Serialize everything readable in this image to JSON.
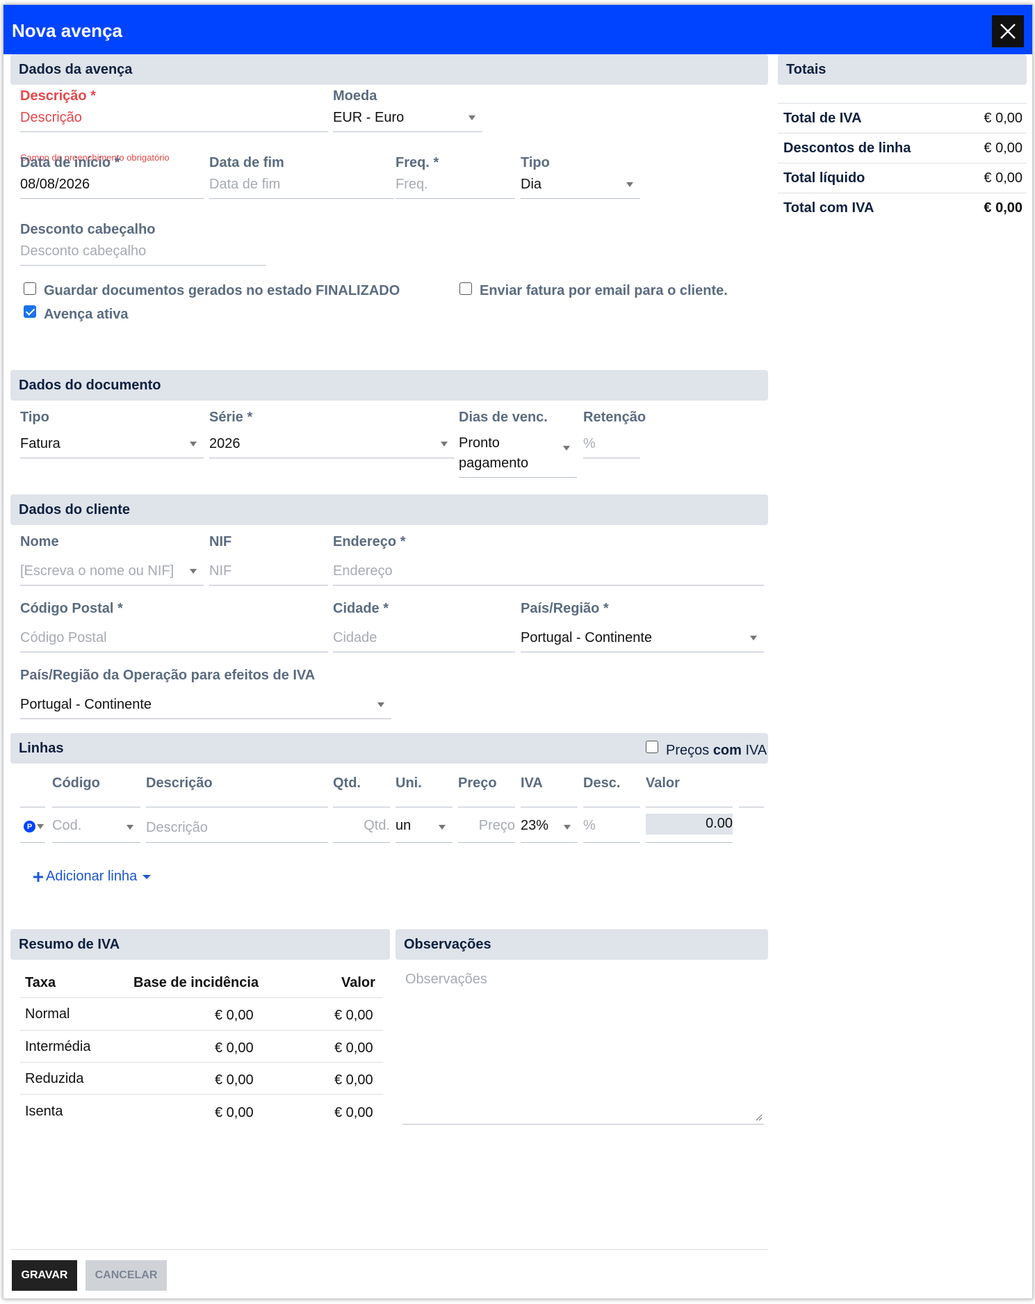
{
  "dialog": {
    "title": "Nova avença",
    "close_label": "×"
  },
  "avenca": {
    "section_title": "Dados da avença",
    "descricao_label": "Descrição *",
    "descricao_placeholder": "Descrição",
    "descricao_error": "Campo de preenchimento obrigatório",
    "moeda_label": "Moeda",
    "moeda_value": "EUR - Euro",
    "data_inicio_label": "Data de início *",
    "data_inicio_value": "08/08/2026",
    "data_fim_label": "Data de fim",
    "data_fim_placeholder": "Data de fim",
    "freq_label": "Freq. *",
    "freq_placeholder": "Freq.",
    "tipo_label": "Tipo",
    "tipo_value": "Dia",
    "desconto_label": "Desconto cabeçalho",
    "desconto_placeholder": "Desconto cabeçalho",
    "guardar_label": "Guardar documentos gerados no estado FINALIZADO",
    "guardar_checked": false,
    "enviar_label": "Enviar fatura por email para o cliente.",
    "enviar_checked": false,
    "ativa_label": "Avença ativa",
    "ativa_checked": true
  },
  "totais": {
    "section_title": "Totais",
    "rows": [
      {
        "label": "Total de IVA",
        "value": "€ 0,00"
      },
      {
        "label": "Descontos de linha",
        "value": "€ 0,00"
      },
      {
        "label": "Total líquido",
        "value": "€ 0,00"
      },
      {
        "label": "Total com IVA",
        "value": "€ 0,00"
      }
    ]
  },
  "documento": {
    "section_title": "Dados do documento",
    "tipo_label": "Tipo",
    "tipo_value": "Fatura",
    "serie_label": "Série *",
    "serie_value": "2026",
    "dias_label": "Dias de venc.",
    "dias_value_1": "Pronto",
    "dias_value_2": "pagamento",
    "retencao_label": "Retenção",
    "retencao_placeholder": "%"
  },
  "cliente": {
    "section_title": "Dados do cliente",
    "nome_label": "Nome",
    "nome_placeholder": "[Escreva o nome ou NIF]",
    "nif_label": "NIF",
    "nif_placeholder": "NIF",
    "endereco_label": "Endereço *",
    "endereco_placeholder": "Endereço",
    "cp_label": "Código Postal *",
    "cp_placeholder": "Código Postal",
    "cidade_label": "Cidade *",
    "cidade_placeholder": "Cidade",
    "pais_label": "País/Região *",
    "pais_value": "Portugal - Continente",
    "pais_iva_label": "País/Região da Operação para efeitos de IVA",
    "pais_iva_value": "Portugal - Continente"
  },
  "linhas": {
    "section_title": "Linhas",
    "precos_iva_label_1": "Preços",
    "precos_iva_label_2": "com",
    "precos_iva_label_3": "IVA",
    "columns": [
      "Código",
      "Descrição",
      "Qtd.",
      "Uni.",
      "Preço",
      "IVA",
      "Desc.",
      "Valor"
    ],
    "row": {
      "product_badge": "P",
      "codigo_placeholder": "Cod.",
      "descricao_placeholder": "Descrição",
      "qtd_placeholder": "Qtd.",
      "uni_value": "un",
      "preco_placeholder": "Preço",
      "iva_value": "23%",
      "desc_placeholder": "%",
      "valor_value": "0.00"
    },
    "add_label": "Adicionar linha"
  },
  "resumo_iva": {
    "section_title": "Resumo de IVA",
    "headers": [
      "Taxa",
      "Base de incidência",
      "Valor"
    ],
    "rows": [
      {
        "taxa": "Normal",
        "base": "€ 0,00",
        "valor": "€ 0,00"
      },
      {
        "taxa": "Intermédia",
        "base": "€ 0,00",
        "valor": "€ 0,00"
      },
      {
        "taxa": "Reduzida",
        "base": "€ 0,00",
        "valor": "€ 0,00"
      },
      {
        "taxa": "Isenta",
        "base": "€ 0,00",
        "valor": "€ 0,00"
      }
    ]
  },
  "observacoes": {
    "section_title": "Observações",
    "placeholder": "Observações"
  },
  "footer": {
    "gravar_label": "GRAVAR",
    "cancelar_label": "CANCELAR"
  }
}
